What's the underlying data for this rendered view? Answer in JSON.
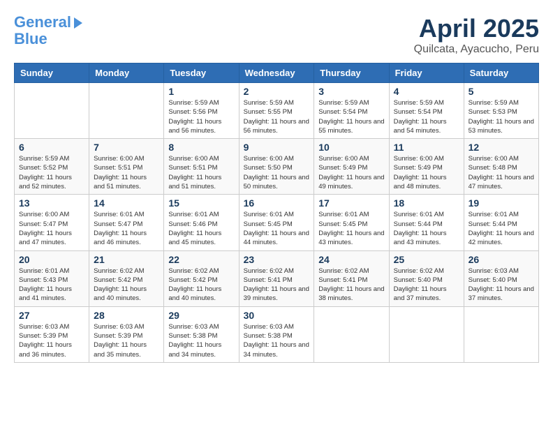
{
  "header": {
    "logo_line1": "General",
    "logo_line2": "Blue",
    "title": "April 2025",
    "subtitle": "Quilcata, Ayacucho, Peru"
  },
  "days_of_week": [
    "Sunday",
    "Monday",
    "Tuesday",
    "Wednesday",
    "Thursday",
    "Friday",
    "Saturday"
  ],
  "weeks": [
    [
      {
        "day": "",
        "info": ""
      },
      {
        "day": "",
        "info": ""
      },
      {
        "day": "1",
        "info": "Sunrise: 5:59 AM\nSunset: 5:56 PM\nDaylight: 11 hours and 56 minutes."
      },
      {
        "day": "2",
        "info": "Sunrise: 5:59 AM\nSunset: 5:55 PM\nDaylight: 11 hours and 56 minutes."
      },
      {
        "day": "3",
        "info": "Sunrise: 5:59 AM\nSunset: 5:54 PM\nDaylight: 11 hours and 55 minutes."
      },
      {
        "day": "4",
        "info": "Sunrise: 5:59 AM\nSunset: 5:54 PM\nDaylight: 11 hours and 54 minutes."
      },
      {
        "day": "5",
        "info": "Sunrise: 5:59 AM\nSunset: 5:53 PM\nDaylight: 11 hours and 53 minutes."
      }
    ],
    [
      {
        "day": "6",
        "info": "Sunrise: 5:59 AM\nSunset: 5:52 PM\nDaylight: 11 hours and 52 minutes."
      },
      {
        "day": "7",
        "info": "Sunrise: 6:00 AM\nSunset: 5:51 PM\nDaylight: 11 hours and 51 minutes."
      },
      {
        "day": "8",
        "info": "Sunrise: 6:00 AM\nSunset: 5:51 PM\nDaylight: 11 hours and 51 minutes."
      },
      {
        "day": "9",
        "info": "Sunrise: 6:00 AM\nSunset: 5:50 PM\nDaylight: 11 hours and 50 minutes."
      },
      {
        "day": "10",
        "info": "Sunrise: 6:00 AM\nSunset: 5:49 PM\nDaylight: 11 hours and 49 minutes."
      },
      {
        "day": "11",
        "info": "Sunrise: 6:00 AM\nSunset: 5:49 PM\nDaylight: 11 hours and 48 minutes."
      },
      {
        "day": "12",
        "info": "Sunrise: 6:00 AM\nSunset: 5:48 PM\nDaylight: 11 hours and 47 minutes."
      }
    ],
    [
      {
        "day": "13",
        "info": "Sunrise: 6:00 AM\nSunset: 5:47 PM\nDaylight: 11 hours and 47 minutes."
      },
      {
        "day": "14",
        "info": "Sunrise: 6:01 AM\nSunset: 5:47 PM\nDaylight: 11 hours and 46 minutes."
      },
      {
        "day": "15",
        "info": "Sunrise: 6:01 AM\nSunset: 5:46 PM\nDaylight: 11 hours and 45 minutes."
      },
      {
        "day": "16",
        "info": "Sunrise: 6:01 AM\nSunset: 5:45 PM\nDaylight: 11 hours and 44 minutes."
      },
      {
        "day": "17",
        "info": "Sunrise: 6:01 AM\nSunset: 5:45 PM\nDaylight: 11 hours and 43 minutes."
      },
      {
        "day": "18",
        "info": "Sunrise: 6:01 AM\nSunset: 5:44 PM\nDaylight: 11 hours and 43 minutes."
      },
      {
        "day": "19",
        "info": "Sunrise: 6:01 AM\nSunset: 5:44 PM\nDaylight: 11 hours and 42 minutes."
      }
    ],
    [
      {
        "day": "20",
        "info": "Sunrise: 6:01 AM\nSunset: 5:43 PM\nDaylight: 11 hours and 41 minutes."
      },
      {
        "day": "21",
        "info": "Sunrise: 6:02 AM\nSunset: 5:42 PM\nDaylight: 11 hours and 40 minutes."
      },
      {
        "day": "22",
        "info": "Sunrise: 6:02 AM\nSunset: 5:42 PM\nDaylight: 11 hours and 40 minutes."
      },
      {
        "day": "23",
        "info": "Sunrise: 6:02 AM\nSunset: 5:41 PM\nDaylight: 11 hours and 39 minutes."
      },
      {
        "day": "24",
        "info": "Sunrise: 6:02 AM\nSunset: 5:41 PM\nDaylight: 11 hours and 38 minutes."
      },
      {
        "day": "25",
        "info": "Sunrise: 6:02 AM\nSunset: 5:40 PM\nDaylight: 11 hours and 37 minutes."
      },
      {
        "day": "26",
        "info": "Sunrise: 6:03 AM\nSunset: 5:40 PM\nDaylight: 11 hours and 37 minutes."
      }
    ],
    [
      {
        "day": "27",
        "info": "Sunrise: 6:03 AM\nSunset: 5:39 PM\nDaylight: 11 hours and 36 minutes."
      },
      {
        "day": "28",
        "info": "Sunrise: 6:03 AM\nSunset: 5:39 PM\nDaylight: 11 hours and 35 minutes."
      },
      {
        "day": "29",
        "info": "Sunrise: 6:03 AM\nSunset: 5:38 PM\nDaylight: 11 hours and 34 minutes."
      },
      {
        "day": "30",
        "info": "Sunrise: 6:03 AM\nSunset: 5:38 PM\nDaylight: 11 hours and 34 minutes."
      },
      {
        "day": "",
        "info": ""
      },
      {
        "day": "",
        "info": ""
      },
      {
        "day": "",
        "info": ""
      }
    ]
  ]
}
